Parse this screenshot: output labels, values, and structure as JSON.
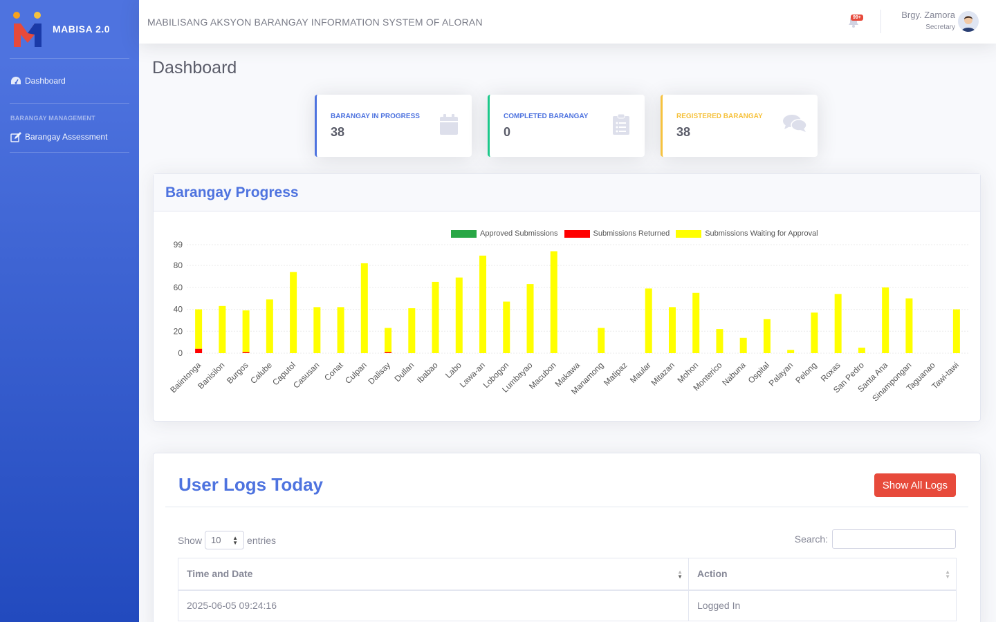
{
  "brand": {
    "name": "MABISA 2.0"
  },
  "sidebar": {
    "items": [
      {
        "label": "Dashboard",
        "icon": "tachometer-icon"
      },
      {
        "label": "Barangay Assessment",
        "icon": "edit-icon"
      }
    ],
    "heading": "BARANGAY MANAGEMENT"
  },
  "topbar": {
    "system_title": "MABILISANG AKSYON BARANGAY INFORMATION SYSTEM OF ALORAN",
    "notification_badge": "99+",
    "user_name": "Brgy. Zamora",
    "user_role": "Secretary"
  },
  "page": {
    "title": "Dashboard"
  },
  "stats": [
    {
      "label": "BARANGAY IN PROGRESS",
      "value": "38",
      "color": "#4e73df",
      "icon": "calendar-icon"
    },
    {
      "label": "COMPLETED BARANGAY",
      "value": "0",
      "color": "#1cc88a",
      "icon": "clipboard-list-icon"
    },
    {
      "label": "REGISTERED BARANGAY",
      "value": "38",
      "color": "#f6c23e",
      "icon": "comments-icon"
    }
  ],
  "progress_card": {
    "title": "Barangay Progress"
  },
  "chart_data": {
    "type": "bar",
    "stacked": true,
    "categories": [
      "Baiintonga",
      "Banisilon",
      "Burgos",
      "Calube",
      "Caputol",
      "Casusan",
      "Conat",
      "Culpan",
      "Dalisay",
      "Dullan",
      "Ibabao",
      "Labo",
      "Lawa-an",
      "Lobogon",
      "Lumbayao",
      "Macubon",
      "Makawa",
      "Manamong",
      "Matipaz",
      "Maular",
      "Mitazan",
      "Mohon",
      "Monterico",
      "Nabuna",
      "Ospital",
      "Palayan",
      "Pelong",
      "Roxas",
      "San Pedro",
      "Santa Ana",
      "Sinampongan",
      "Taguanao",
      "Tawi-tawi"
    ],
    "series": [
      {
        "name": "Approved Submissions",
        "color": "#28a745",
        "values": [
          0,
          0,
          0,
          0,
          0,
          0,
          0,
          0,
          0,
          0,
          0,
          0,
          0,
          0,
          0,
          0,
          0,
          0,
          0,
          0,
          0,
          0,
          0,
          0,
          0,
          0,
          0,
          0,
          0,
          0,
          0,
          0,
          0
        ]
      },
      {
        "name": "Submissions Returned",
        "color": "#ff0000",
        "values": [
          4,
          0,
          1,
          0,
          0,
          0,
          0,
          0,
          1,
          0,
          0,
          0,
          0,
          0,
          0,
          0,
          0,
          0,
          0,
          0,
          0,
          0,
          0,
          0,
          0,
          0,
          0,
          0,
          0,
          0,
          0,
          0,
          0
        ]
      },
      {
        "name": "Submissions Waiting for Approval",
        "color": "#ffff00",
        "values": [
          36,
          43,
          38,
          49,
          74,
          42,
          42,
          82,
          22,
          41,
          65,
          69,
          89,
          47,
          63,
          93,
          0,
          23,
          0,
          59,
          42,
          55,
          22,
          14,
          31,
          3,
          37,
          54,
          5,
          60,
          50,
          0,
          40
        ]
      }
    ],
    "yticks": [
      0,
      20,
      40,
      60,
      80,
      99
    ],
    "ylim": [
      0,
      99
    ],
    "grid": true,
    "legend": "top"
  },
  "logs": {
    "title": "User Logs Today",
    "show_all_label": "Show All Logs",
    "show_label": "Show",
    "entries_value": "10",
    "entries_label": "entries",
    "search_label": "Search:",
    "columns": [
      "Time and Date",
      "Action"
    ],
    "rows": [
      [
        "2025-06-05 09:24:16",
        "Logged In"
      ]
    ]
  }
}
